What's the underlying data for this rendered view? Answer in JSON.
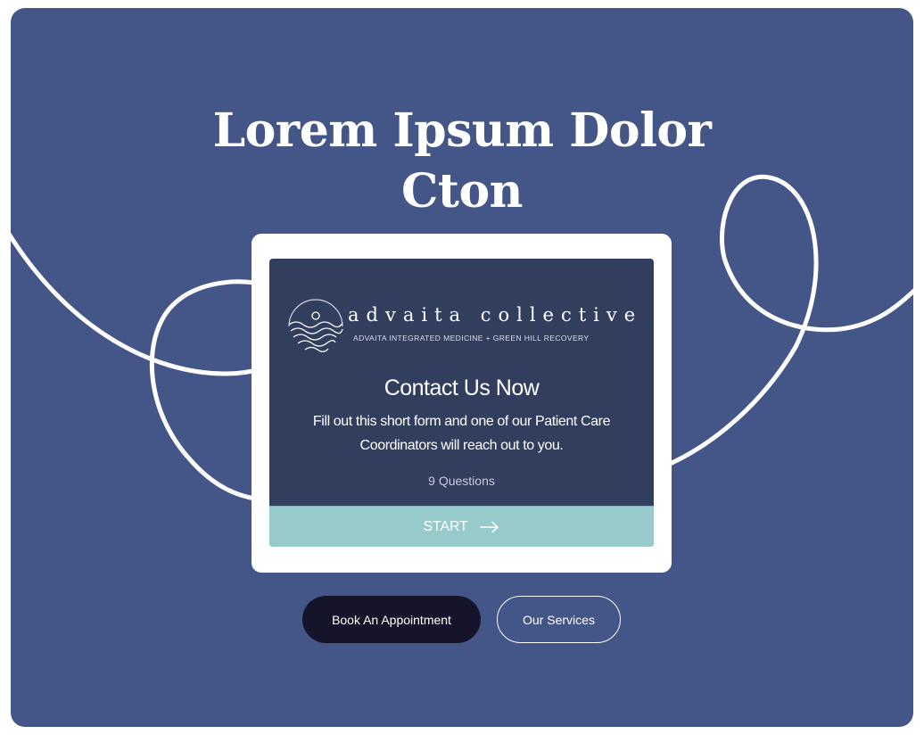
{
  "hero": {
    "title_line1": "Lorem Ipsum Dolor",
    "title_line2": "Cton"
  },
  "form_card": {
    "brand_name": "advaita collective",
    "brand_tagline": "ADVAITA INTEGRATED MEDICINE + GREEN HILL RECOVERY",
    "title": "Contact Us Now",
    "description": "Fill out this short form and one of our Patient Care Coordinators will reach out to you.",
    "question_count": "9 Questions",
    "start_label": "START",
    "start_icon": "arrow-right-icon",
    "logo_icon": "sun-over-waves-logo"
  },
  "buttons": {
    "book_label": "Book An Appointment",
    "services_label": "Our Services"
  },
  "colors": {
    "hero_background": "#445688",
    "card_background": "#323e5e",
    "start_button": "#97cacb",
    "book_button": "#15142b",
    "decorative_line": "#ffffff"
  }
}
